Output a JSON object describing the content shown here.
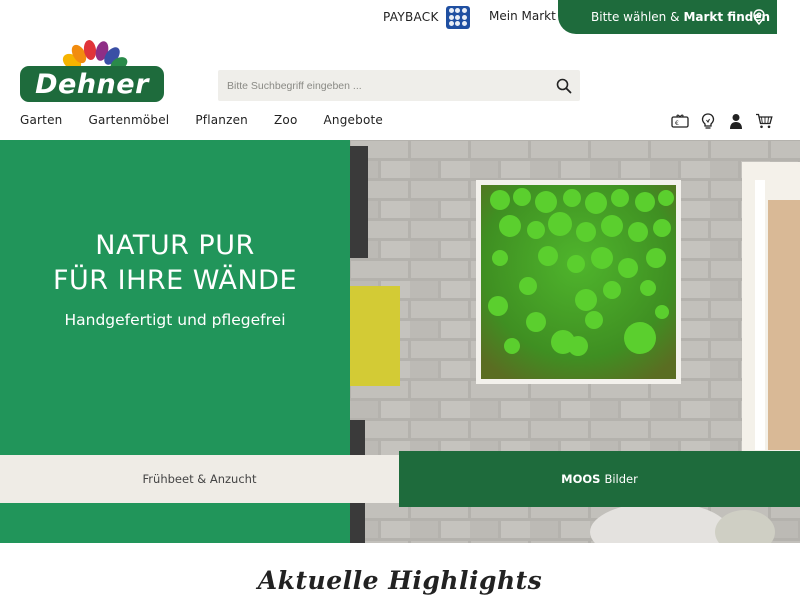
{
  "topbar": {
    "payback_label": "PAYBACK",
    "mein_markt_label": "Mein Markt",
    "markt_finden_prefix": "Bitte wählen &",
    "markt_finden_bold": "Markt finden"
  },
  "logo": {
    "text": "Dehner"
  },
  "search": {
    "placeholder": "Bitte Suchbegriff eingeben ...",
    "value": ""
  },
  "nav": {
    "items": [
      {
        "label": "Garten"
      },
      {
        "label": "Gartenmöbel"
      },
      {
        "label": "Pflanzen"
      },
      {
        "label": "Zoo"
      },
      {
        "label": "Angebote"
      }
    ],
    "icons": [
      "gift-card-icon",
      "lightbulb-icon",
      "user-icon",
      "cart-icon"
    ]
  },
  "hero": {
    "title_line1": "NATUR PUR",
    "title_line2": "FÜR IHRE WÄNDE",
    "subtitle": "Handgefertigt und pflegefrei",
    "tabs": [
      {
        "label": "Frühbeet & Anzucht",
        "bold": ""
      },
      {
        "bold": "MOOS",
        "label": "Bilder"
      }
    ]
  },
  "section": {
    "heading": "Aktuelle Highlights"
  },
  "colors": {
    "brand_green": "#1e6b3c",
    "hero_green": "#21955a",
    "search_bg": "#efeeea",
    "payback_blue": "#1f4fa1"
  }
}
